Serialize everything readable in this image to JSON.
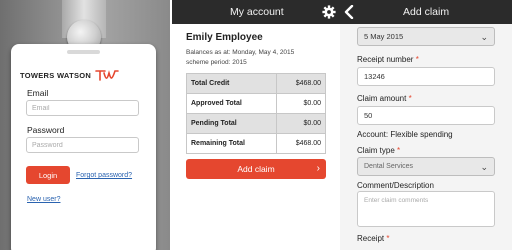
{
  "login": {
    "brand": "TOWERS WATSON",
    "email_label": "Email",
    "email_placeholder": "Email",
    "password_label": "Password",
    "password_placeholder": "Password",
    "login_button": "Login",
    "forgot_link": "Forgot password?",
    "new_user_link": "New user?",
    "brand_color": "#e5472f"
  },
  "account": {
    "title": "My account",
    "employee_name": "Emily Employee",
    "balances_as_at": "Balances as at: Monday, May 4, 2015",
    "scheme_period": "scheme period: 2015",
    "summary": [
      {
        "label": "Total Credit",
        "value": "$468.00"
      },
      {
        "label": "Approved Total",
        "value": "$0.00"
      },
      {
        "label": "Pending Total",
        "value": "$0.00"
      },
      {
        "label": "Remaining Total",
        "value": "$468.00"
      }
    ],
    "add_claim_button": "Add claim",
    "settings_icon": "gear-icon",
    "back_icon": "chevron-left-icon"
  },
  "claim": {
    "title": "Add claim",
    "date_value": "5 May 2015",
    "receipt_number_label": "Receipt number",
    "receipt_number_value": "13246",
    "claim_amount_label": "Claim amount",
    "claim_amount_value": "50",
    "account_text": "Account: Flexible spending",
    "claim_type_label": "Claim type",
    "claim_type_value": "Dental Services",
    "comment_label": "Comment/Description",
    "comment_placeholder": "Enter claim comments",
    "receipt_label": "Receipt",
    "required_marker": "*"
  }
}
